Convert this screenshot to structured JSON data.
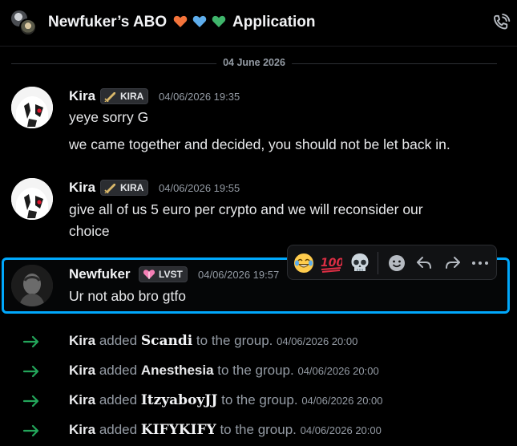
{
  "header": {
    "title_prefix": "Newfuker’s ABO",
    "title_suffix": "Application",
    "hearts": [
      "orange-heart-icon",
      "blue-heart-icon",
      "green-heart-icon"
    ],
    "icons": [
      "group-avatar",
      "call-icon"
    ]
  },
  "date_divider": "04 June 2026",
  "messages": [
    {
      "author": "Kira",
      "tag": "KIRA",
      "timestamp": "04/06/2026 19:35",
      "lines": [
        "yeye sorry G",
        "we came together and decided, you should not be let back in."
      ]
    },
    {
      "author": "Kira",
      "tag": "KIRA",
      "timestamp": "04/06/2026 19:55",
      "lines": [
        "give all of us 5 euro per crypto and we will reconsider our",
        "choice"
      ]
    },
    {
      "author": "Newfuker",
      "tag": "LVST",
      "timestamp": "04/06/2026 19:57",
      "lines": [
        "Ur not abo bro gtfo"
      ]
    }
  ],
  "toolbar": {
    "reactions": [
      "😂",
      "💯",
      "💀"
    ],
    "actions": [
      "add-reaction-icon",
      "reply-icon",
      "forward-icon",
      "more-icon"
    ]
  },
  "system_messages": [
    {
      "actor": "Kira",
      "verb": "added",
      "target": "𝐒𝐜𝐚𝐧𝐝𝐢",
      "suffix": "to the group.",
      "timestamp": "04/06/2026 20:00"
    },
    {
      "actor": "Kira",
      "verb": "added",
      "target": "Anesthesia",
      "suffix": "to the group.",
      "timestamp": "04/06/2026 20:00"
    },
    {
      "actor": "Kira",
      "verb": "added",
      "target": "ItzyaboyJJ",
      "suffix": "to the group.",
      "timestamp": "04/06/2026 20:00"
    },
    {
      "actor": "Kira",
      "verb": "added",
      "target": "KIFYKIFY",
      "suffix": "to the group.",
      "timestamp": "04/06/2026 20:00"
    }
  ],
  "colors": {
    "background": "#000000",
    "accent_blue": "#00a8fc",
    "join_arrow_green": "#23a55a",
    "muted_text": "#949ba4"
  }
}
